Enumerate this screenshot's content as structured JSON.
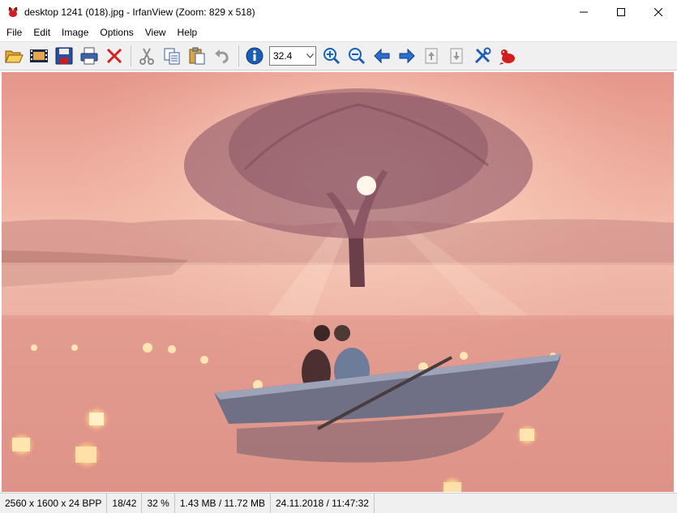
{
  "window": {
    "title": "desktop 1241 (018).jpg - IrfanView (Zoom: 829 x 518)",
    "app_icon": "irfanview-cat-icon",
    "controls": [
      "minimize-icon",
      "maximize-icon",
      "close-icon"
    ]
  },
  "menu": {
    "items": [
      {
        "label": "File"
      },
      {
        "label": "Edit"
      },
      {
        "label": "Image"
      },
      {
        "label": "Options"
      },
      {
        "label": "View"
      },
      {
        "label": "Help"
      }
    ]
  },
  "toolbar": {
    "zoom_value": "32.4",
    "buttons": [
      "open-folder-icon",
      "slideshow-icon",
      "save-icon",
      "print-icon",
      "delete-icon",
      "cut-icon",
      "copy-icon",
      "paste-icon",
      "undo-icon",
      "info-icon",
      "zoom-in-icon",
      "zoom-out-icon",
      "previous-icon",
      "next-icon",
      "first-page-icon",
      "last-page-icon",
      "settings-icon",
      "irfanview-about-icon"
    ]
  },
  "colors": {
    "sky_top": "#e79b8c",
    "sky_glow": "#f6c4b5",
    "water": "#d88a80",
    "boat": "#6f6f86",
    "lantern": "#ffd79a",
    "accent_blue": "#1a5fb4",
    "delete_red": "#d21f1f"
  },
  "status": {
    "dimensions": "2560 x 1600 x 24 BPP",
    "index": "18/42",
    "zoom": "32 %",
    "size": "1.43 MB / 11.72 MB",
    "datetime": "24.11.2018 / 11:47:32"
  }
}
